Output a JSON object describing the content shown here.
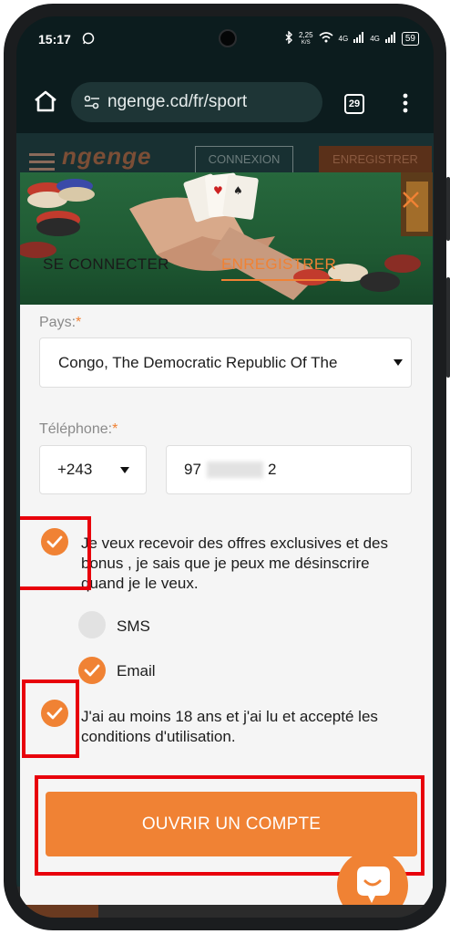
{
  "status_bar": {
    "time": "15:17",
    "speed": "2,25",
    "speed_unit": "K/S",
    "net1": "4G",
    "net2": "4G",
    "battery": "59"
  },
  "browser": {
    "url": "ngenge.cd/fr/sport",
    "tab_count": "29"
  },
  "site_header": {
    "logo": "ngenge",
    "login_button": "CONNEXION",
    "register_button": "ENREGISTRER"
  },
  "modal": {
    "tabs": [
      {
        "label": "SE CONNECTER",
        "active": false
      },
      {
        "label": "ENREGISTRER",
        "active": true
      }
    ],
    "country": {
      "label": "Pays:",
      "required_mark": "*",
      "value": "Congo, The Democratic Republic Of The"
    },
    "phone": {
      "label": "Téléphone:",
      "required_mark": "*",
      "prefix": "+243",
      "number_start": "97",
      "number_end": "2"
    },
    "offers_consent": {
      "checked": true,
      "text": "Je veux recevoir des offres exclusives et des bonus , je sais que je peux me désinscrire quand je le veux."
    },
    "channels": [
      {
        "label": "SMS",
        "checked": false
      },
      {
        "label": "Email",
        "checked": true
      }
    ],
    "age_consent": {
      "checked": true,
      "text": "J'ai au moins 18 ans et j'ai lu et accepté les conditions d'utilisation."
    },
    "submit_button": "OUVRIR UN COMPTE"
  },
  "colors": {
    "accent": "#f08234",
    "highlight": "#e8000b",
    "browser_bg": "#0c1c1e"
  }
}
